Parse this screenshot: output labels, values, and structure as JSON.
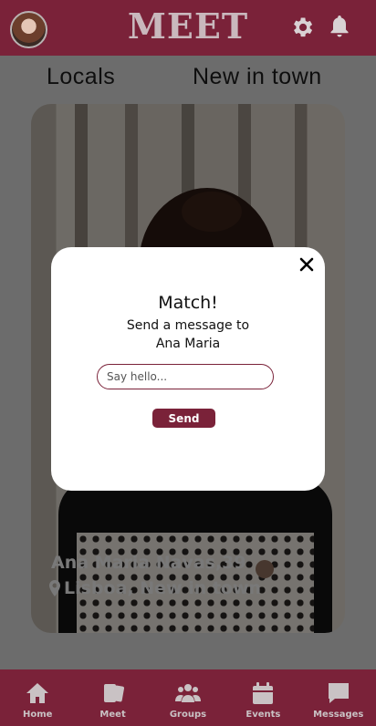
{
  "header": {
    "logo": "MEET"
  },
  "tabs": [
    {
      "label": "Locals"
    },
    {
      "label": "New in town"
    }
  ],
  "profile_card": {
    "name_age": "Ana Maria Navas,39",
    "location": "Lisboa, New in town"
  },
  "match_modal": {
    "title": "Match!",
    "subtitle_line1": "Send a message to",
    "subtitle_line2": "Ana Maria",
    "input_placeholder": "Say hello...",
    "send_label": "Send"
  },
  "bottom_nav": [
    {
      "label": "Home",
      "icon": "home-icon"
    },
    {
      "label": "Meet",
      "icon": "cards-icon"
    },
    {
      "label": "Groups",
      "icon": "groups-icon"
    },
    {
      "label": "Events",
      "icon": "calendar-icon"
    },
    {
      "label": "Messages",
      "icon": "chat-icon"
    }
  ],
  "colors": {
    "brand": "#7a2239",
    "nav_text": "#c9c2c4"
  }
}
